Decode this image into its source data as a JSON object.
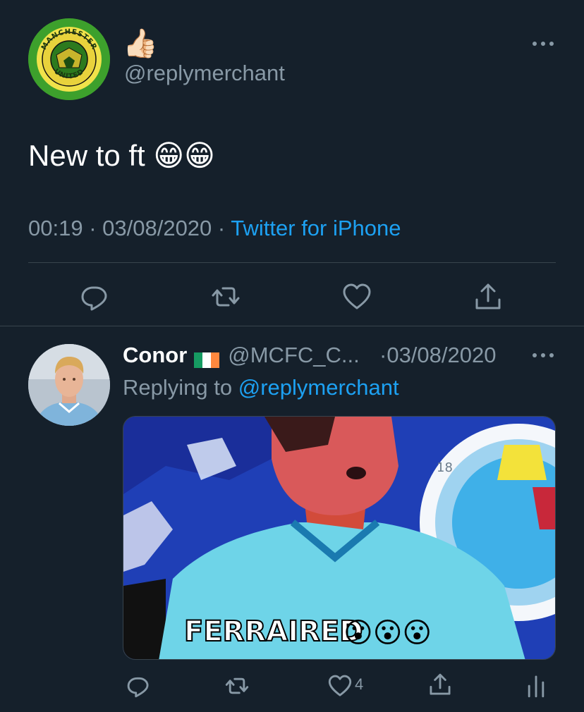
{
  "main_tweet": {
    "display_name_emoji": "👍🏻",
    "handle": "@replymerchant",
    "avatar_text_top": "MANCHESTER",
    "avatar_text_bottom": "UNITED",
    "text": "New to ft 😁😁",
    "time": "00:19",
    "date": "03/08/2020",
    "separator": " · ",
    "source": "Twitter for iPhone",
    "actions": [
      "reply-icon",
      "retweet-icon",
      "like-icon",
      "share-icon"
    ]
  },
  "reply_tweet": {
    "name": "Conor",
    "flag": "🇮🇪",
    "handle": "@MCFC_C...",
    "date_prefix": "·",
    "date": "03/08/2020",
    "replying_prefix": "Replying to ",
    "replying_to": "@replymerchant",
    "image_caption": "FERRAIRED",
    "image_emojis": "😮😮😮",
    "image_badge_number": "18",
    "like_count": "4",
    "actions": [
      "reply-icon",
      "retweet-icon",
      "like-icon",
      "share-icon",
      "stats-icon"
    ]
  },
  "colors": {
    "background": "#15202b",
    "secondary_text": "#8899a6",
    "link": "#1da1f2",
    "divider": "#38444d"
  }
}
